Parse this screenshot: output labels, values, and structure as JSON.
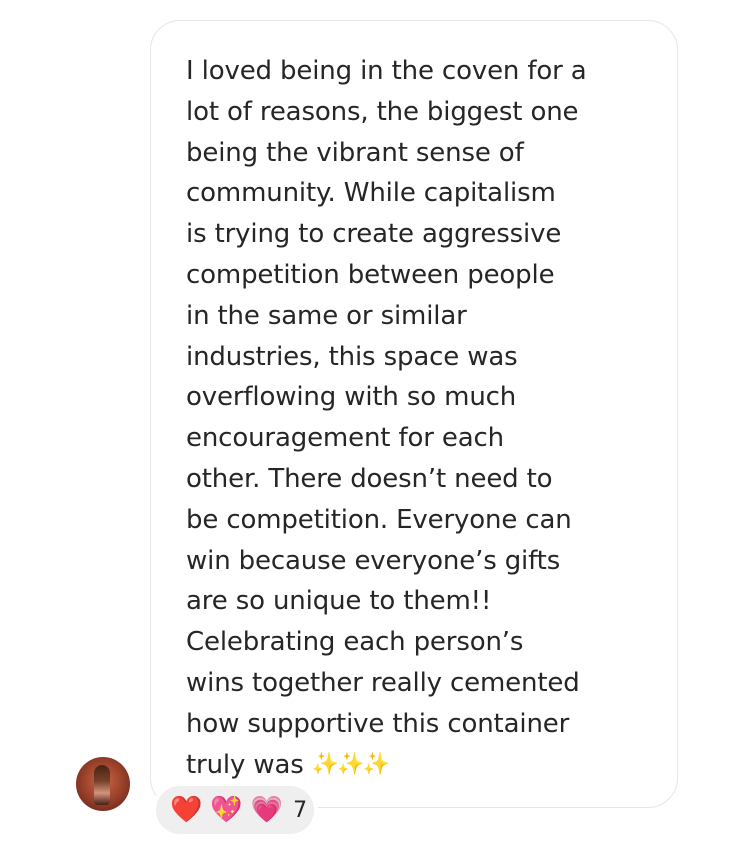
{
  "message": {
    "lines": [
      "I loved being in the coven for a",
      "lot of reasons, the biggest one",
      "being the vibrant sense of",
      "community. While capitalism",
      "is trying to create aggressive",
      "competition between people",
      "in the same or similar",
      "industries, this space was",
      "overflowing with so much",
      "encouragement for each",
      "other. There doesn’t need to",
      "be competition. Everyone can",
      "win because everyone’s gifts",
      "are so unique to them!!",
      "Celebrating each person’s",
      "wins together really cemented",
      "how supportive this container",
      "truly was"
    ],
    "trailing_emoji": "✨✨✨"
  },
  "reactions": {
    "emojis": [
      "❤️",
      "💖",
      "💗"
    ],
    "count": "7"
  },
  "icons": {
    "avatar": "user-avatar-photo",
    "reaction_1": "red-heart-icon",
    "reaction_2": "sparkling-heart-icon",
    "reaction_3": "growing-heart-icon"
  },
  "colors": {
    "text": "#262626",
    "bubble_border": "#e6e6e6",
    "reaction_pill": "#efefef"
  }
}
